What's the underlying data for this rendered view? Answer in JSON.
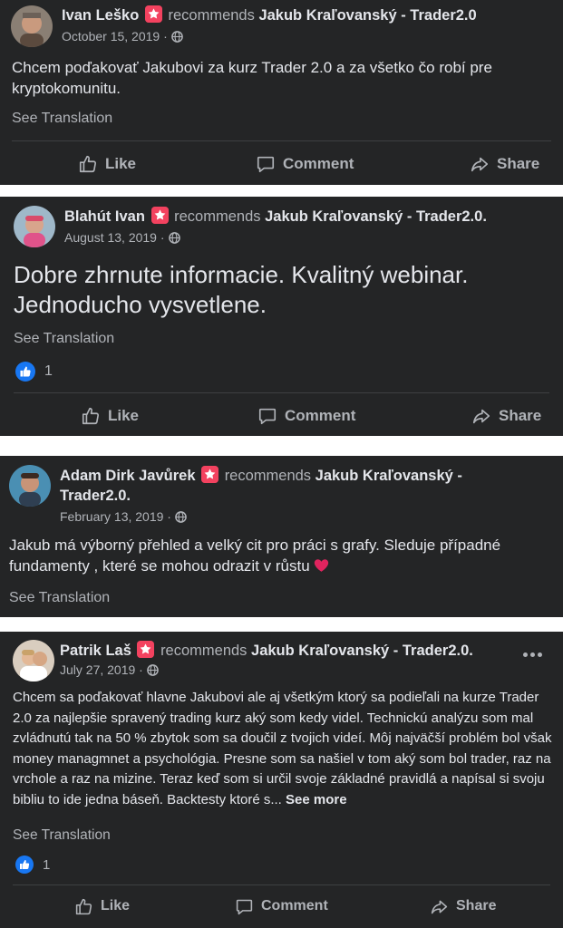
{
  "colors": {
    "card_bg": "#242526",
    "text": "#e4e6eb",
    "secondary": "#b0b3b8",
    "recommend_star": "#f3425f",
    "like_blue": "#1877f2",
    "heart": "#e0245e"
  },
  "actions": {
    "like": "Like",
    "comment": "Comment",
    "share": "Share"
  },
  "posts": [
    {
      "author": "Ivan Leško",
      "recommends": "recommends",
      "page": "Jakub Kraľovanský - Trader2.0",
      "date": "October 15, 2019 ·",
      "text": "Chcem poďakovať Jakubovi za kurz Trader 2.0 a za všetko čo robí pre kryptokomunitu.",
      "translation": "See Translation"
    },
    {
      "author": "Blahút Ivan",
      "recommends": "recommends",
      "page": "Jakub Kraľovanský - Trader2.0.",
      "date": "August 13, 2019 ·",
      "text": "Dobre zhrnute informacie. Kvalitný webinar. Jednoducho vysvetlene.",
      "translation": "See Translation",
      "like_count": "1"
    },
    {
      "author": "Adam Dirk Javůrek",
      "recommends": "recommends",
      "page": "Jakub Kraľovanský - Trader2.0.",
      "date": "February 13, 2019 ·",
      "text": "Jakub má výborný přehled a velký cit pro práci s grafy. Sleduje případné fundamenty , které se mohou odrazit v růstu",
      "translation": "See Translation"
    },
    {
      "author": "Patrik Laš",
      "recommends": "recommends",
      "page": "Jakub Kraľovanský - Trader2.0.",
      "date": "July 27, 2019 ·",
      "text": "Chcem sa poďakovať hlavne Jakubovi ale aj všetkým ktorý sa podieľali na kurze Trader 2.0 za najlepšie spravený trading kurz aký som kedy videl. Technickú analýzu som mal zvládnutú tak na 50 % zbytok som sa doučil z tvojich videí. Môj najväčší problém bol však money managmnet a psychológia. Presne som sa našiel v tom aký som bol trader, raz na vrchole a raz na mizine. Teraz keď som si určil svoje základné pravidlá a napísal si svoju bibliu to ide jedna báseň. Backtesty ktoré s...",
      "see_more": "See more",
      "translation": "See Translation",
      "like_count": "1"
    }
  ]
}
